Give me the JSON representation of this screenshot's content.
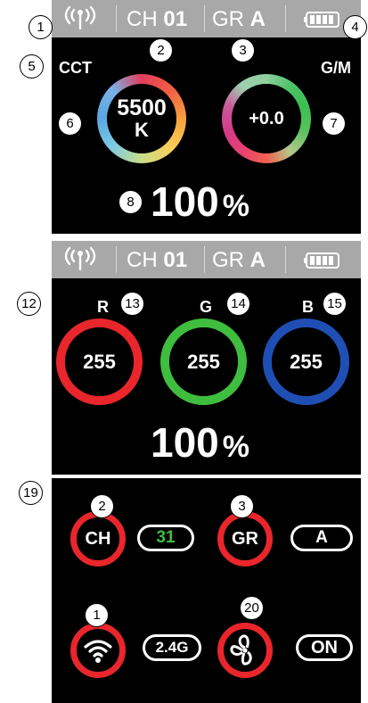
{
  "colors": {
    "screen": "#000000",
    "status_bar": "#a8a8a8",
    "red": "#e8262b",
    "green": "#3fbd3e",
    "blue": "#1f4fb5",
    "channel_value": "#3fbd3e"
  },
  "status_bar": {
    "signal_icon": "wireless-signal-icon",
    "channel_prefix": "CH",
    "channel_value": "01",
    "group_prefix": "GR",
    "group_value": "A",
    "battery_icon": "battery-full-icon"
  },
  "cct_screen": {
    "left_label": "CCT",
    "right_label": "G/M",
    "cct_value": "5500",
    "cct_unit": "K",
    "gm_value": "+0.0",
    "brightness": "100",
    "brightness_unit": "%"
  },
  "rgb_screen": {
    "r_label": "R",
    "g_label": "G",
    "b_label": "B",
    "r_value": "255",
    "g_value": "255",
    "b_value": "255",
    "brightness": "100",
    "brightness_unit": "%"
  },
  "menu_screen": {
    "channel_label": "CH",
    "channel_value": "31",
    "group_label": "GR",
    "group_value": "A",
    "frequency_icon": "wifi-icon",
    "frequency_value": "2.4G",
    "fan_icon": "fan-icon",
    "fan_value": "ON"
  },
  "callouts": {
    "c1": "1",
    "c2": "2",
    "c3": "3",
    "c4": "4",
    "c5": "5",
    "c6": "6",
    "c7": "7",
    "c8": "8",
    "c12": "12",
    "c13": "13",
    "c14": "14",
    "c15": "15",
    "c19": "19",
    "c2b": "2",
    "c3b": "3",
    "c1b": "1",
    "c20": "20"
  }
}
